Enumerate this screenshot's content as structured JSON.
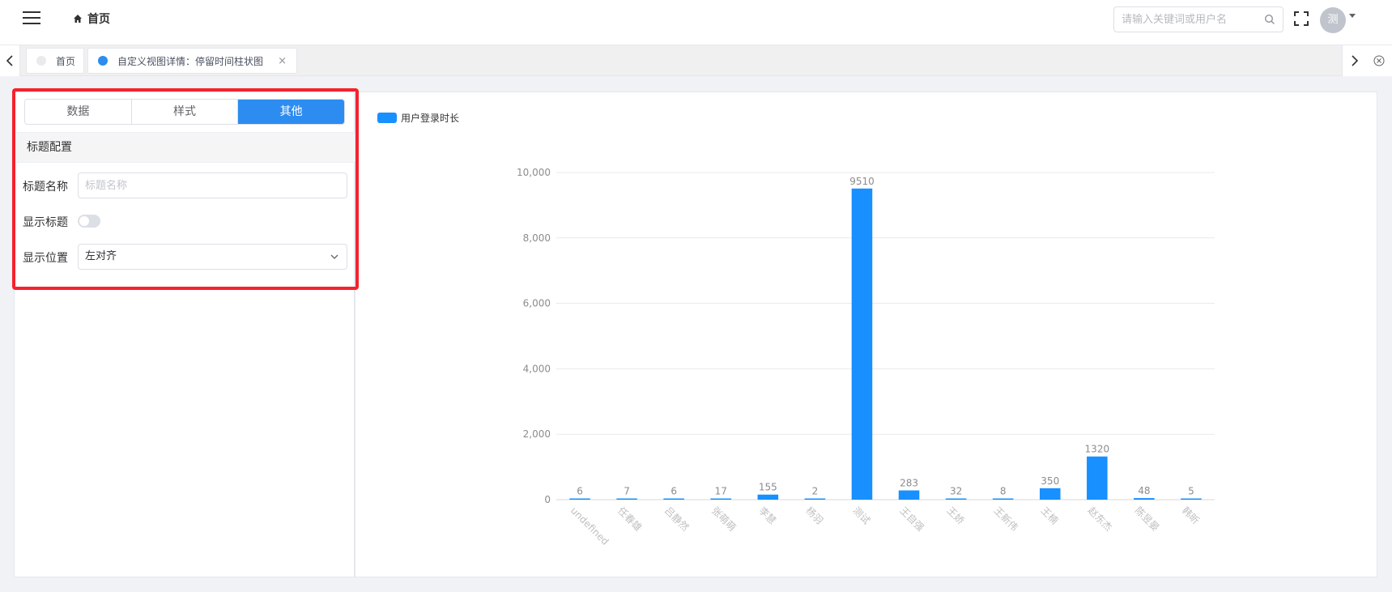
{
  "header": {
    "breadcrumb": "首页",
    "search_placeholder": "请输入关键词或用户名",
    "avatar_text": "测"
  },
  "tabs": [
    {
      "label": "首页",
      "active": false
    },
    {
      "label": "自定义视图详情：停留时间柱状图",
      "active": true,
      "close": "×"
    }
  ],
  "config_panel": {
    "segments": [
      "数据",
      "样式",
      "其他"
    ],
    "active_segment": "其他",
    "section_title": "标题配置",
    "title_name_label": "标题名称",
    "title_name_placeholder": "标题名称",
    "title_name_value": "",
    "show_title_label": "显示标题",
    "show_title": false,
    "position_label": "显示位置",
    "position_value": "左对齐"
  },
  "colors": {
    "accent": "#2d8cf0",
    "bar": "#1890ff",
    "highlight_frame": "#f5222d"
  },
  "chart_data": {
    "type": "bar",
    "legend": [
      "用户登录时长"
    ],
    "categories": [
      "undefined",
      "任春雄",
      "吕静然",
      "张萌萌",
      "李慧",
      "杨羽",
      "测试",
      "王自强",
      "王娇",
      "王新伟",
      "王楠",
      "赵东杰",
      "陈昱晏",
      "韩昕"
    ],
    "series": [
      {
        "name": "用户登录时长",
        "values": [
          6,
          7,
          6,
          17,
          155,
          2,
          9510,
          283,
          32,
          8,
          350,
          1320,
          48,
          5
        ]
      }
    ],
    "y_ticks": [
      "0",
      "2,000",
      "4,000",
      "6,000",
      "8,000",
      "10,000"
    ],
    "ylim": [
      0,
      10000
    ],
    "grid": true,
    "legend_position": "top-left"
  }
}
